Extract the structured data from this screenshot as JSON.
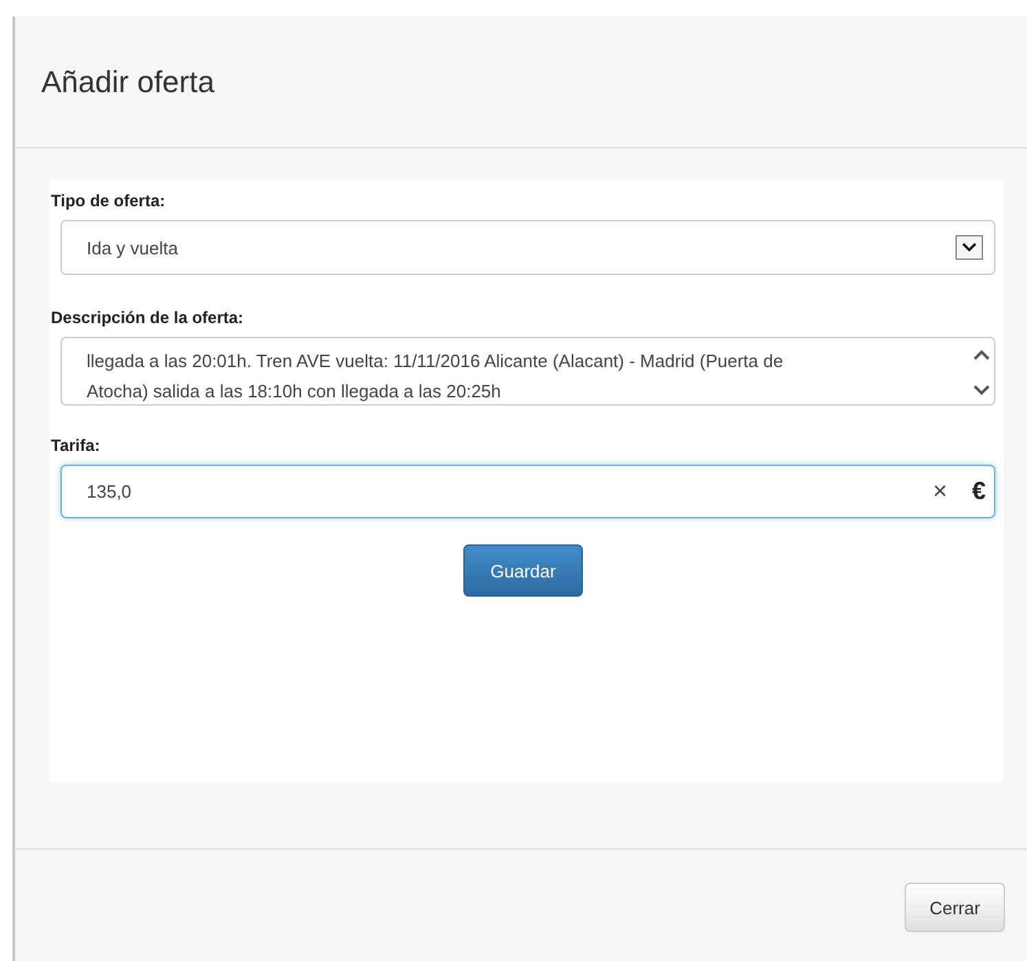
{
  "dialog": {
    "title": "Añadir oferta"
  },
  "form": {
    "offer_type": {
      "label": "Tipo de oferta:",
      "value": "Ida y vuelta"
    },
    "description": {
      "label": "Descripción de la oferta:",
      "lines": [
        "llegada a las 20:01h. Tren AVE vuelta: 11/11/2016 Alicante (Alacant) - Madrid (Puerta de",
        "Atocha) salida a las 18:10h con llegada a las 20:25h"
      ]
    },
    "fare": {
      "label": "Tarifa:",
      "value": "135,0",
      "focused": true,
      "clear": "×",
      "currency": "€"
    },
    "save_button": "Guardar"
  },
  "footer": {
    "buttons": [
      "Cerrar"
    ]
  }
}
